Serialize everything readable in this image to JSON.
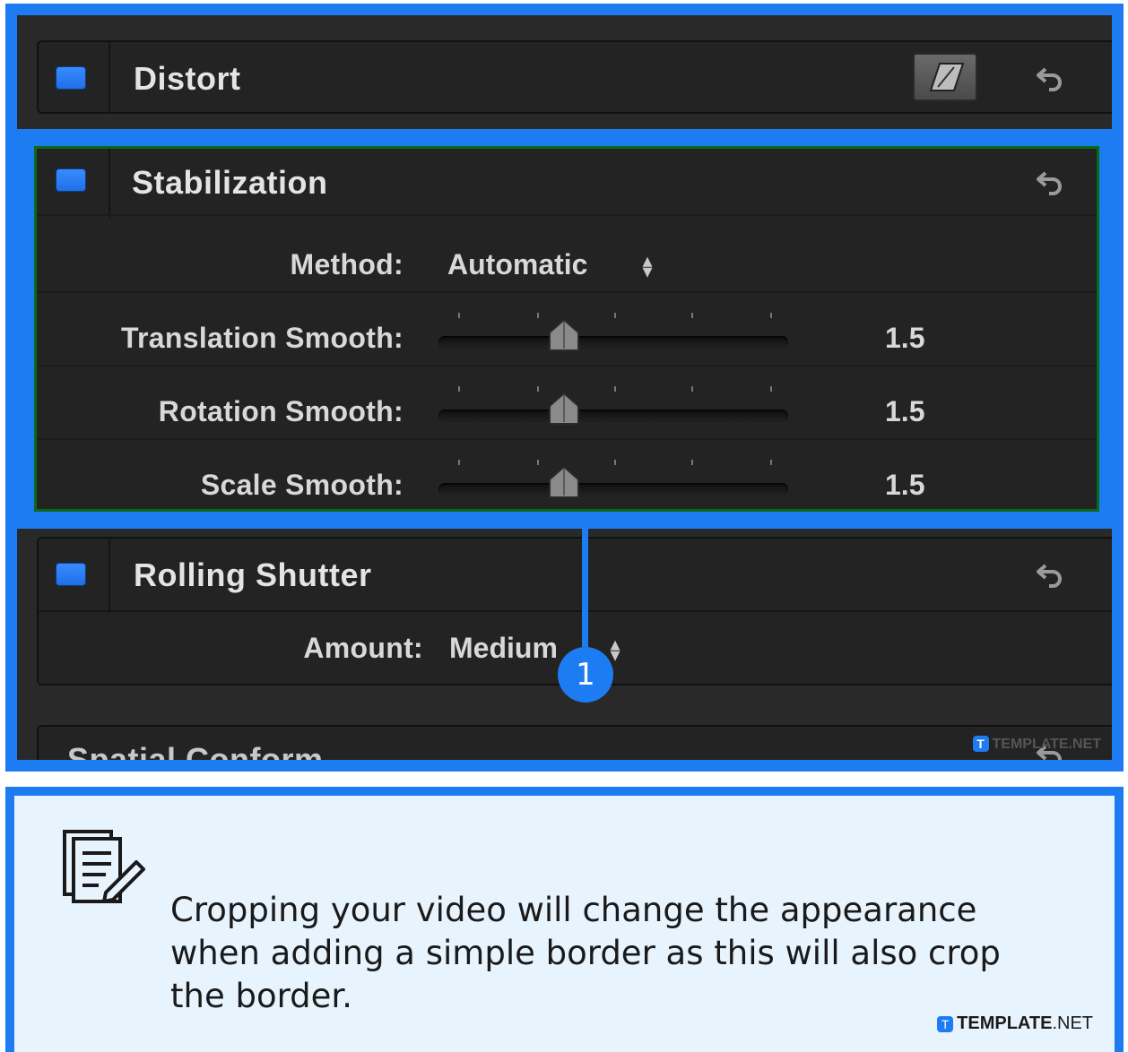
{
  "sections": {
    "distort": {
      "title": "Distort"
    },
    "stabilization": {
      "title": "Stabilization",
      "method": {
        "label": "Method:",
        "value": "Automatic"
      },
      "sliders": [
        {
          "label": "Translation Smooth:",
          "value": "1.5"
        },
        {
          "label": "Rotation Smooth:",
          "value": "1.5"
        },
        {
          "label": "Scale Smooth:",
          "value": "1.5"
        }
      ]
    },
    "rolling_shutter": {
      "title": "Rolling Shutter",
      "amount": {
        "label": "Amount:",
        "value": "Medium"
      }
    },
    "spatial_conform": {
      "title": "Spatial Conform"
    }
  },
  "callout": {
    "step": "1"
  },
  "watermark_small": {
    "badge": "T",
    "text": "TEMPLATE.NET"
  },
  "note": {
    "icon": "notes-pencil-icon",
    "text": "Cropping your video will change the appearance when adding a simple border as this will also crop the border."
  },
  "watermark": {
    "badge": "T",
    "brand": "TEMPLATE",
    "suffix": ".NET"
  },
  "colors": {
    "accent": "#1e7cf2",
    "panel": "#232323",
    "note_bg": "#e7f3fd",
    "checkbox": "#2f80ff"
  }
}
